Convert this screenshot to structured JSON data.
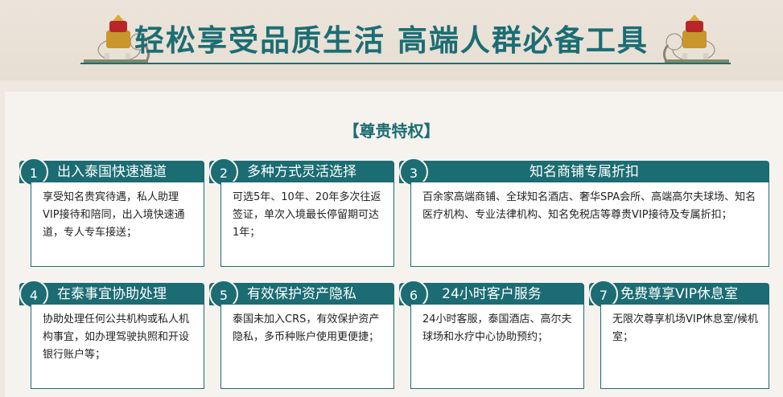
{
  "header": {
    "title": "轻松享受品质生活   高端人群必备工具"
  },
  "section": {
    "title": "【尊贵特权】"
  },
  "cards": [
    {
      "num": "1",
      "title": "出入泰国快速通道",
      "body": "享受知名贵宾待遇，私人助理VIP接待和陪同，出入境快速通道，专人专车接送；"
    },
    {
      "num": "2",
      "title": "多种方式灵活选择",
      "body": "可选5年、10年、20年多次往返签证，单次入境最长停留期可达1年；"
    },
    {
      "num": "3",
      "title": "知名商铺专属折扣",
      "body": "百余家高端商铺、全球知名酒店、奢华SPA会所、高端高尔夫球场、知名医疗机构、专业法律机构、知名免税店等尊贵VIP接待及专属折扣；"
    },
    {
      "num": "4",
      "title": "在泰事宜协助处理",
      "body": "协助处理任何公共机构或私人机构事宜，如办理驾驶执照和开设银行账户等；"
    },
    {
      "num": "5",
      "title": "有效保护资产隐私",
      "body": "泰国未加入CRS，有效保护资产隐私，多币种账户使用更便捷；"
    },
    {
      "num": "6",
      "title": "24小时客户服务",
      "body": "24小时客服，泰国酒店、高尔夫球场和水疗中心协助预约；"
    },
    {
      "num": "7",
      "title": "免费尊享VIP休息室",
      "body": "无限次尊享机场VIP休息室/候机室；"
    }
  ],
  "colors": {
    "accent": "#1b6c73",
    "background": "#efe8e0",
    "panel": "#f6f3ee",
    "elephant_gold": "#c9962c"
  },
  "icons": [
    "elephant-icon"
  ]
}
